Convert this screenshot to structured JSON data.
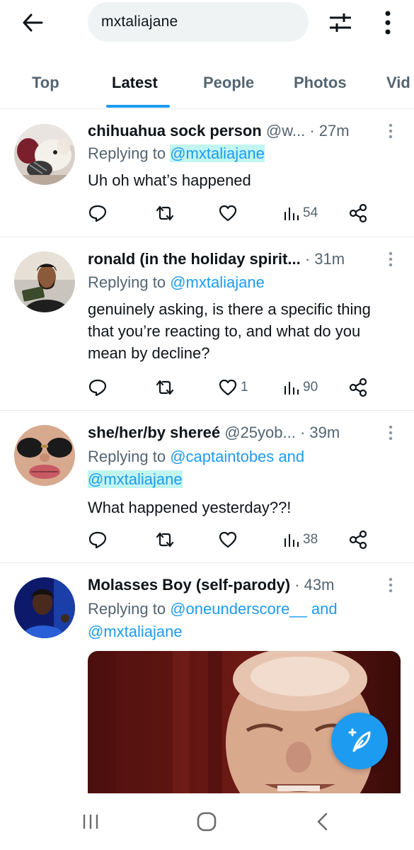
{
  "search": {
    "query": "mxtaliajane"
  },
  "tabs": [
    {
      "label": "Top"
    },
    {
      "label": "Latest",
      "active": true
    },
    {
      "label": "People"
    },
    {
      "label": "Photos"
    },
    {
      "label": "Vid"
    }
  ],
  "colors": {
    "accent": "#1d9bf0",
    "text": "#0f1419",
    "muted": "#536471",
    "highlight": "#40e0d0"
  },
  "tweets": [
    {
      "name": "chihuahua sock person",
      "handle": "@w...",
      "time": "· 27m",
      "replying_prefix": "Replying to",
      "mentions": "@mxtaliajane",
      "body": "Uh oh what’s happened",
      "likes": "",
      "views": "54"
    },
    {
      "name": "ronald (in the holiday spirit...",
      "handle": "",
      "time": "· 31m",
      "replying_prefix": "Replying to",
      "mentions": "@mxtaliajane",
      "body": "genuinely asking, is there a specific thing that you’re reacting to, and what do you mean by decline?",
      "likes": "1",
      "views": "90"
    },
    {
      "name": "she/her/by shereé",
      "handle": "@25yob...",
      "time": "· 39m",
      "replying_prefix": "Replying to",
      "mentions_line1": "@captaintobes and",
      "mentions_line2": "@mxtaliajane",
      "body": "What happened yesterday??!",
      "likes": "",
      "views": "38"
    },
    {
      "name": "Molasses Boy (self-parody)",
      "handle": "",
      "time": "· 43m",
      "replying_prefix": "Replying to",
      "mentions_line1": "@oneunderscore__ and",
      "mentions_line2": "@mxtaliajane"
    }
  ],
  "icons": {
    "back": "arrow-left-icon",
    "filter": "sliders-icon",
    "more": "kebab-menu-icon",
    "reply": "reply-bubble-icon",
    "retweet": "retweet-icon",
    "like": "heart-icon",
    "views": "bar-chart-icon",
    "share": "share-icon",
    "compose": "compose-feather-icon"
  }
}
